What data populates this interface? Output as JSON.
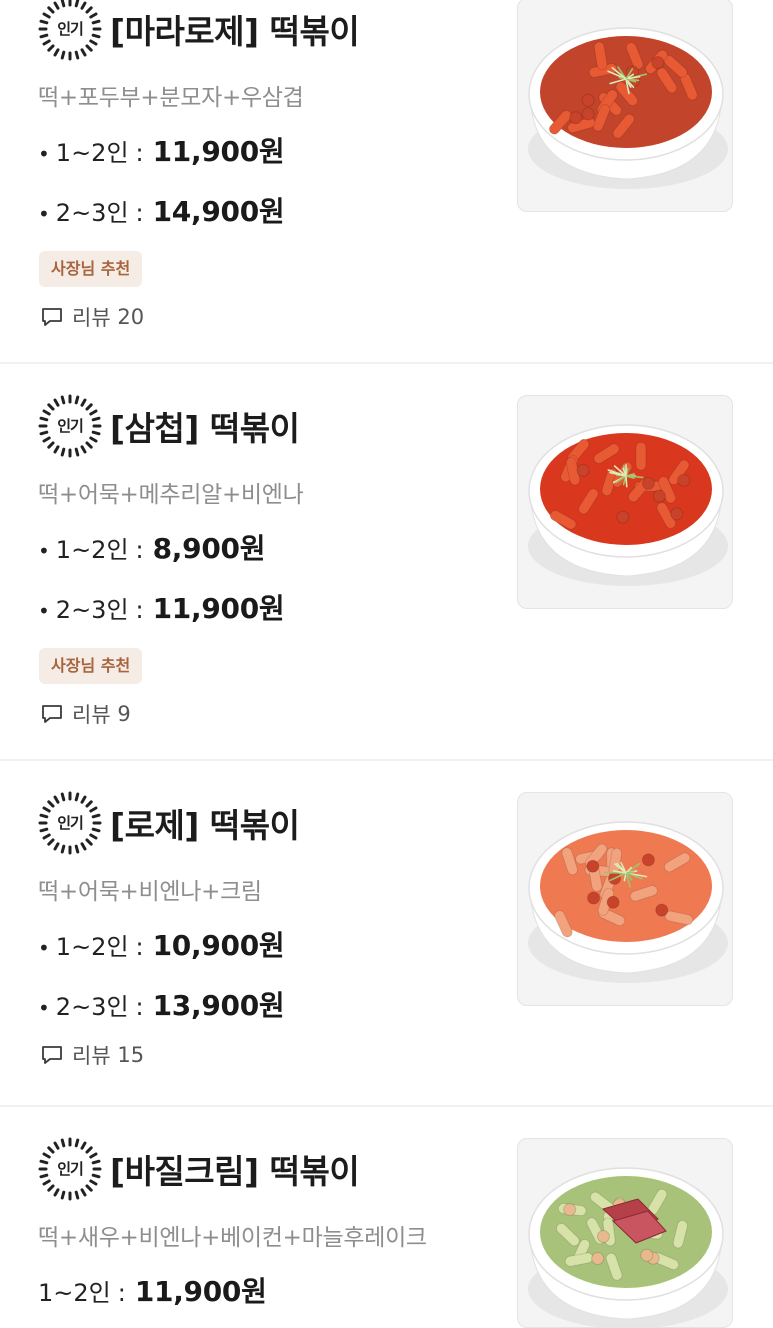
{
  "badge_label": "인기",
  "owner_tag_label": "사장님 추천",
  "review_prefix": "리뷰",
  "bullet": "•",
  "colon": ":",
  "menu_items": [
    {
      "name": "[마라로제] 떡볶이",
      "description": "떡+포두부+분모자+우삼겹",
      "prices": [
        {
          "size": "1~2인",
          "price": "11,900원"
        },
        {
          "size": "2~3인",
          "price": "14,900원"
        }
      ],
      "owner_recommended": true,
      "review_count": "20",
      "dish": "mala-rose-tteokbokki",
      "sauce_color": "#c2442a"
    },
    {
      "name": "[삼첩] 떡볶이",
      "description": "떡+어묵+메추리알+비엔나",
      "prices": [
        {
          "size": "1~2인",
          "price": "8,900원"
        },
        {
          "size": "2~3인",
          "price": "11,900원"
        }
      ],
      "owner_recommended": true,
      "review_count": "9",
      "dish": "samcheop-tteokbokki",
      "sauce_color": "#d9381f"
    },
    {
      "name": "[로제] 떡볶이",
      "description": "떡+어묵+비엔나+크림",
      "prices": [
        {
          "size": "1~2인",
          "price": "10,900원"
        },
        {
          "size": "2~3인",
          "price": "13,900원"
        }
      ],
      "owner_recommended": false,
      "review_count": "15",
      "dish": "rose-tteokbokki",
      "sauce_color": "#ef7a52"
    },
    {
      "name": "[바질크림] 떡볶이",
      "description": "떡+새우+비엔나+베이컨+마늘후레이크",
      "prices": [
        {
          "size": "1~2인",
          "price": "11,900원"
        }
      ],
      "owner_recommended": false,
      "review_count": "",
      "dish": "basil-cream-tteokbokki",
      "sauce_color": "#a9c27a"
    }
  ]
}
